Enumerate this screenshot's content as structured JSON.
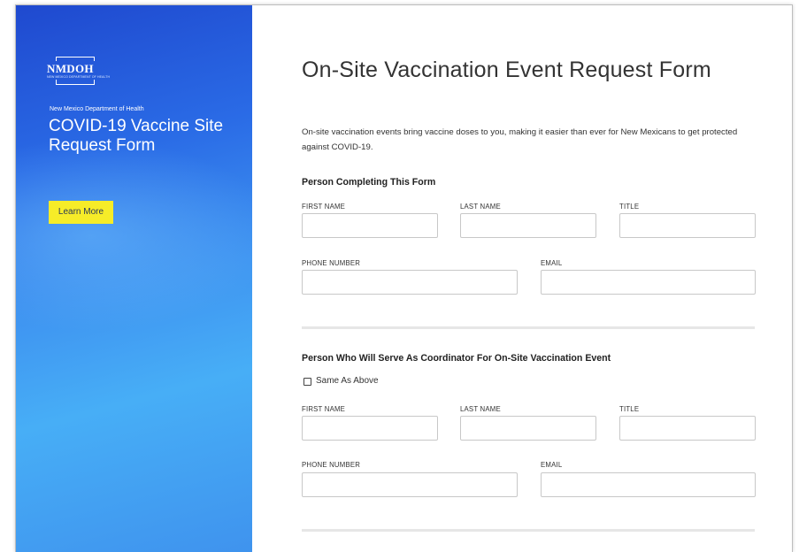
{
  "sidebar": {
    "logo_text": "NMDOH",
    "logo_subtext": "NEW MEXICO DEPARTMENT OF HEALTH",
    "department": "New Mexico Department of Health",
    "title": "COVID-19 Vaccine Site Request Form",
    "learn_more_label": "Learn More"
  },
  "main": {
    "title": "On-Site Vaccination Event Request Form",
    "intro": "On-site vaccination events bring vaccine doses to you, making it easier than ever for New Mexicans to get protected against COVID-19.",
    "section1": {
      "heading": "Person Completing This Form",
      "first_name_label": "FIRST NAME",
      "last_name_label": "LAST NAME",
      "title_label": "TITLE",
      "phone_label": "PHONE NUMBER",
      "email_label": "EMAIL",
      "first_name_value": "",
      "last_name_value": "",
      "title_value": "",
      "phone_value": "",
      "email_value": ""
    },
    "section2": {
      "heading": "Person Who Will Serve As Coordinator For On-Site Vaccination Event",
      "same_as_above_label": "Same As Above",
      "same_as_above_checked": false,
      "first_name_label": "FIRST NAME",
      "last_name_label": "LAST NAME",
      "title_label": "TITLE",
      "phone_label": "PHONE NUMBER",
      "email_label": "EMAIL",
      "first_name_value": "",
      "last_name_value": "",
      "title_value": "",
      "phone_value": "",
      "email_value": ""
    }
  },
  "colors": {
    "sidebar_gradient_start": "#1f49cf",
    "sidebar_gradient_end": "#47aef6",
    "button_yellow": "#f6ec28",
    "text_dark": "#333333"
  }
}
